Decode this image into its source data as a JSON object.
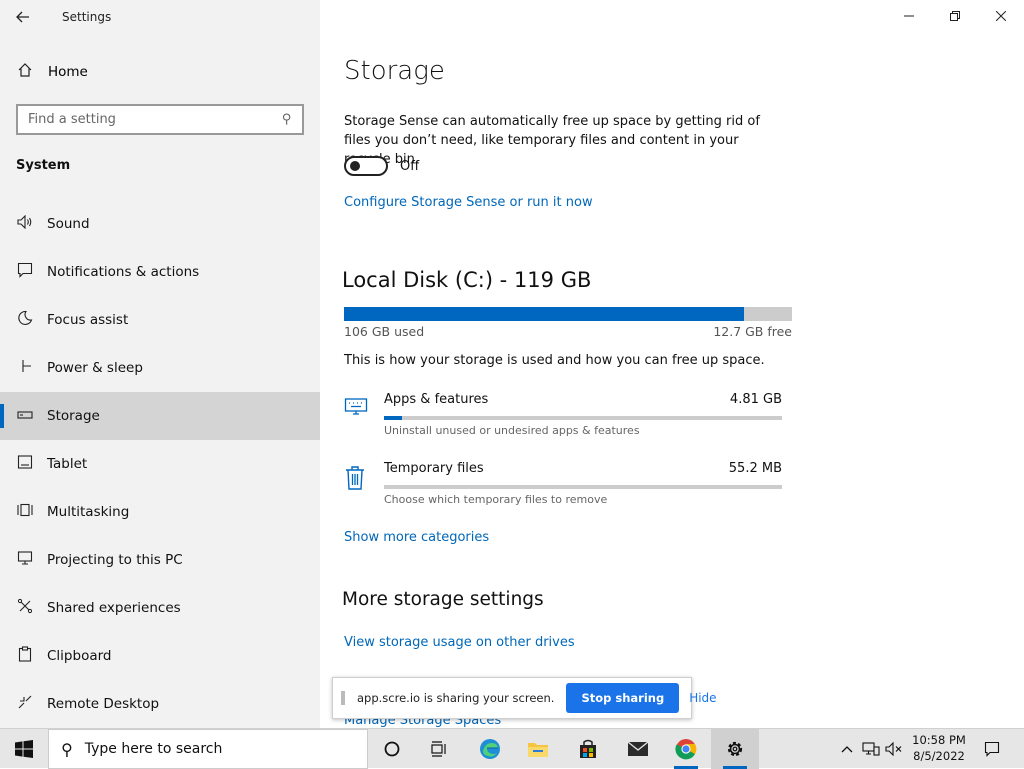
{
  "window": {
    "title": "Settings",
    "controls": {
      "minimize": "—",
      "maximize": "❐",
      "close": "✕"
    }
  },
  "sidebar": {
    "home_label": "Home",
    "search_placeholder": "Find a setting",
    "section_label": "System",
    "items": [
      {
        "label": "Sound",
        "icon": "speaker-icon"
      },
      {
        "label": "Notifications & actions",
        "icon": "notification-icon"
      },
      {
        "label": "Focus assist",
        "icon": "moon-icon"
      },
      {
        "label": "Power & sleep",
        "icon": "power-icon"
      },
      {
        "label": "Storage",
        "icon": "storage-icon",
        "active": true
      },
      {
        "label": "Tablet",
        "icon": "tablet-icon"
      },
      {
        "label": "Multitasking",
        "icon": "multitasking-icon"
      },
      {
        "label": "Projecting to this PC",
        "icon": "projecting-icon"
      },
      {
        "label": "Shared experiences",
        "icon": "shared-icon"
      },
      {
        "label": "Clipboard",
        "icon": "clipboard-icon"
      },
      {
        "label": "Remote Desktop",
        "icon": "remote-desktop-icon"
      }
    ]
  },
  "main": {
    "title": "Storage",
    "description": "Storage Sense can automatically free up space by getting rid of files you don’t need, like temporary files and content in your recycle bin.",
    "storage_sense_toggle": {
      "state": "Off",
      "on": false
    },
    "configure_link": "Configure Storage Sense or run it now",
    "disk": {
      "title": "Local Disk (C:) - 119 GB",
      "used_label": "106 GB used",
      "free_label": "12.7 GB free",
      "used_fraction": 0.893
    },
    "usage_note": "This is how your storage is used and how you can free up space.",
    "categories": [
      {
        "name": "Apps & features",
        "size": "4.81 GB",
        "subtitle": "Uninstall unused or undesired apps & features",
        "fraction": 0.045,
        "icon": "keyboard-icon"
      },
      {
        "name": "Temporary files",
        "size": "55.2 MB",
        "subtitle": "Choose which temporary files to remove",
        "fraction": 0.0,
        "icon": "trash-icon"
      }
    ],
    "show_more_link": "Show more categories",
    "more_settings_title": "More storage settings",
    "view_other_drives_link": "View storage usage on other drives",
    "manage_spaces_link": "Manage Storage Spaces"
  },
  "share_bar": {
    "message": "app.scre.io is sharing your screen.",
    "stop_label": "Stop sharing",
    "hide_label": "Hide"
  },
  "taskbar": {
    "search_placeholder": "Type here to search",
    "time": "10:58 PM",
    "date": "8/5/2022",
    "accent": "#0067c0"
  }
}
